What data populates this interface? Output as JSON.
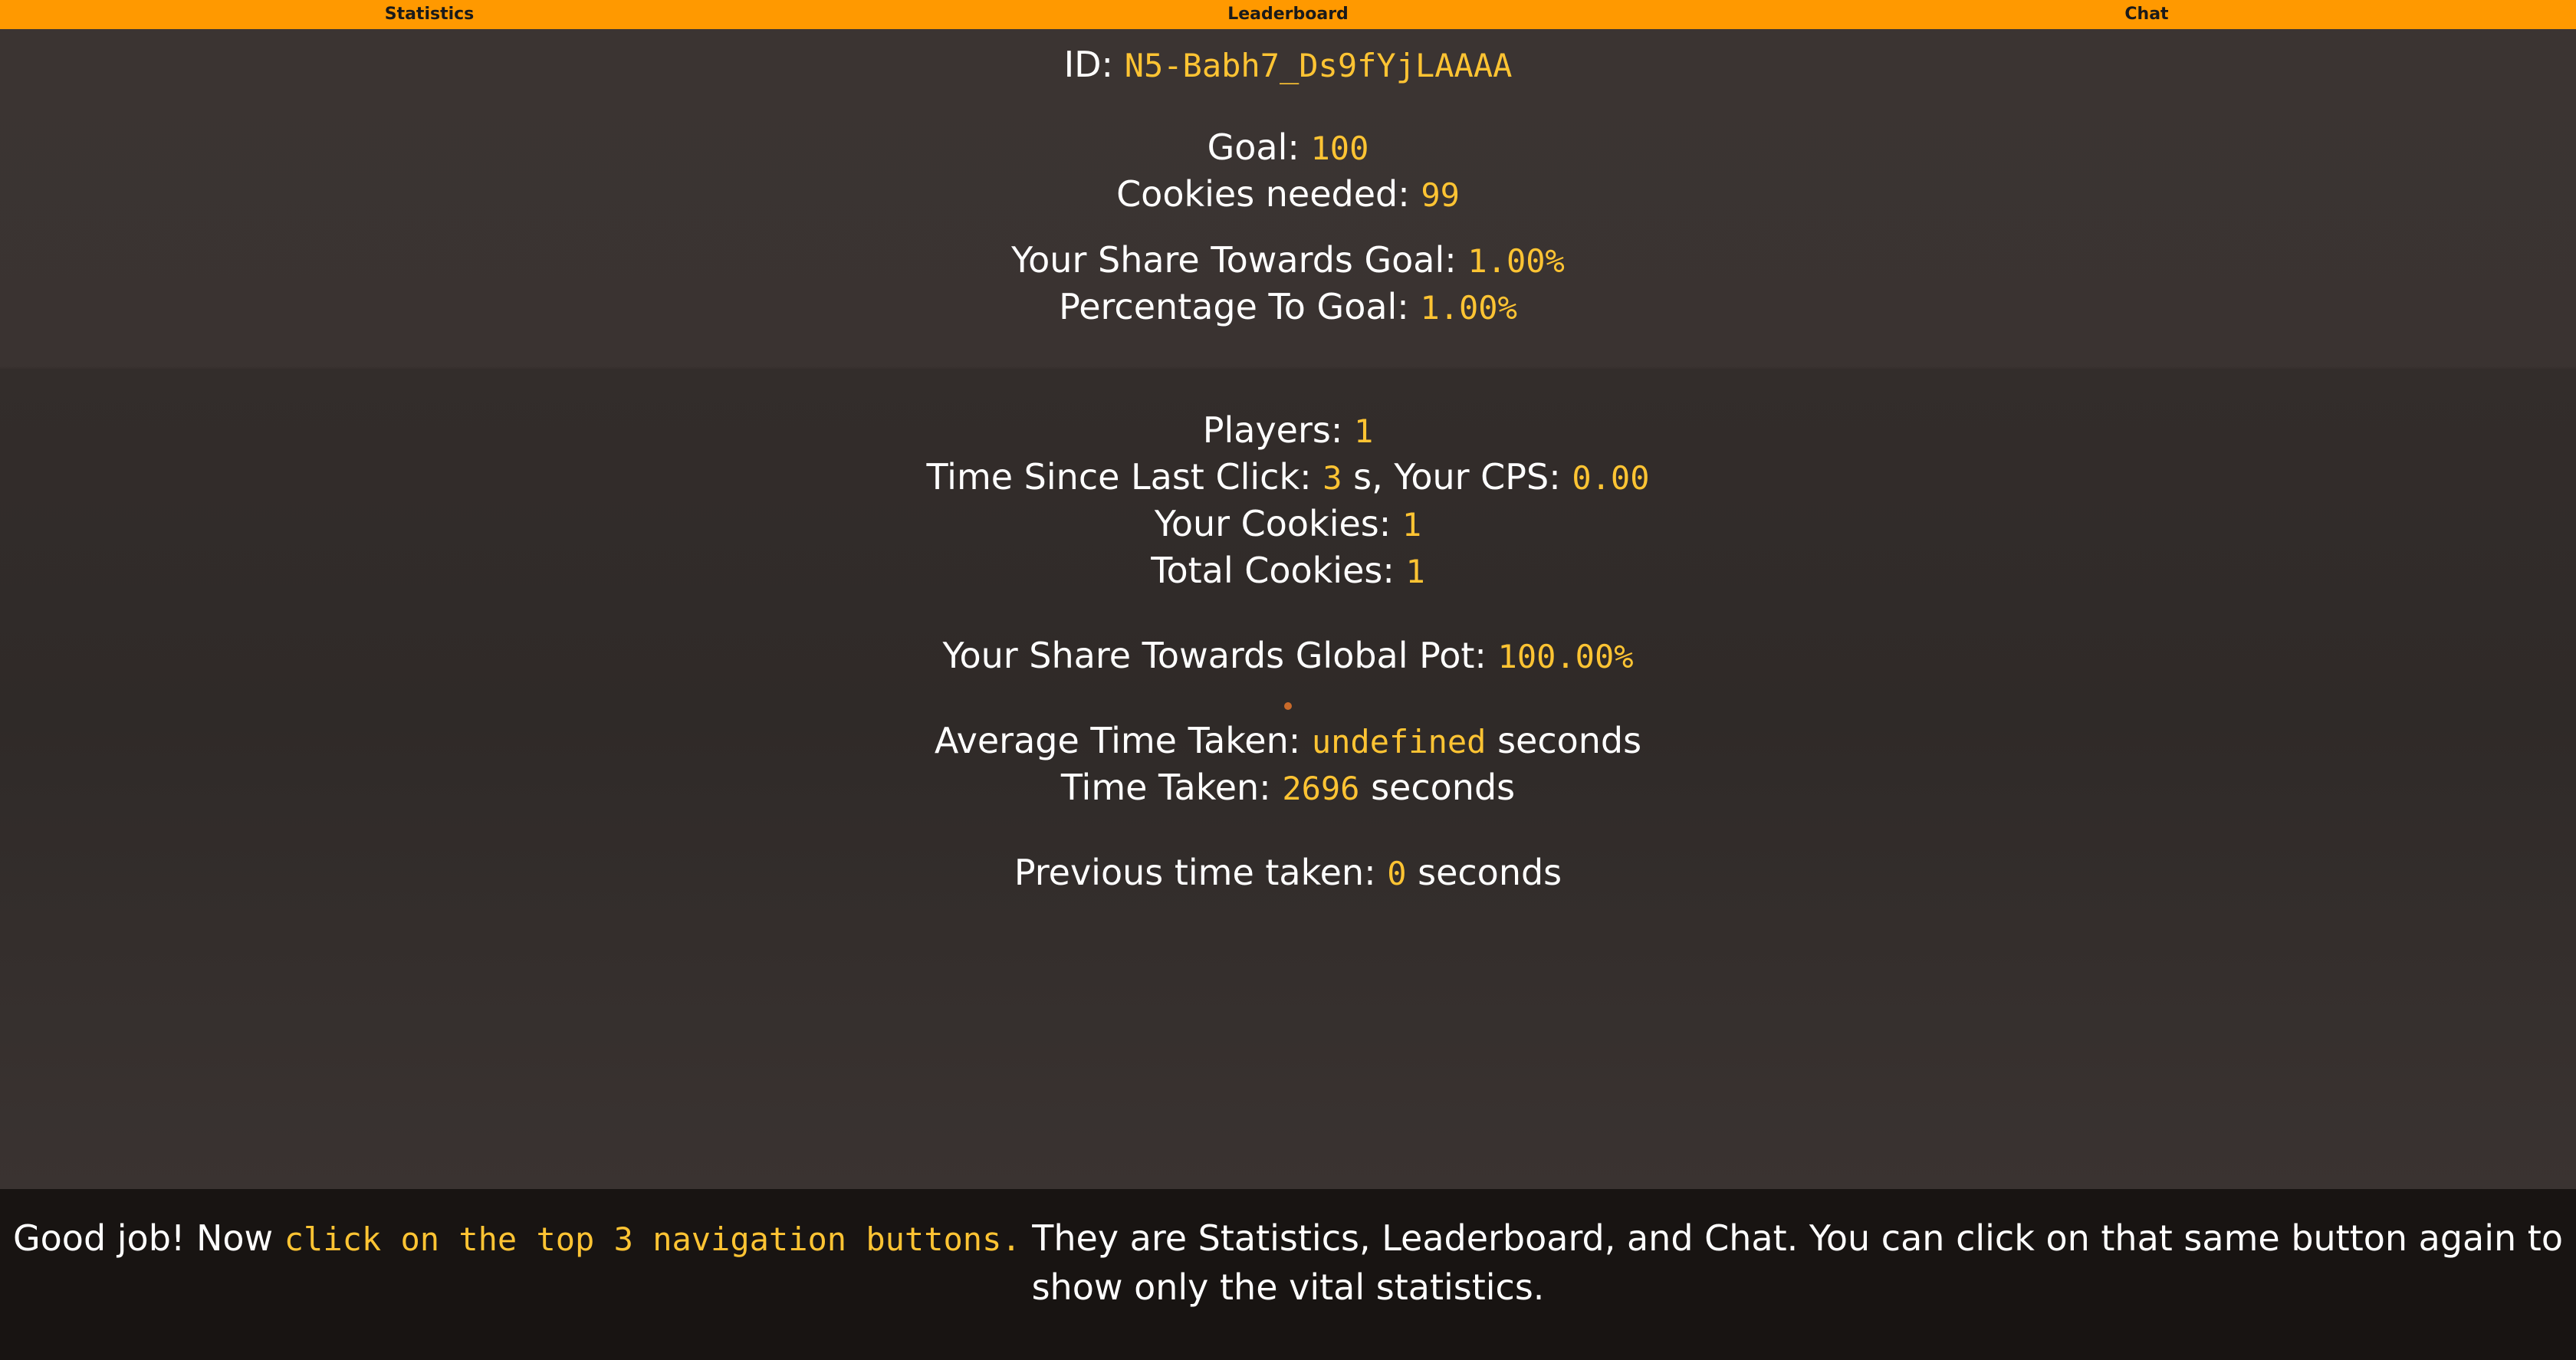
{
  "nav": {
    "statistics": "Statistics",
    "leaderboard": "Leaderboard",
    "chat": "Chat"
  },
  "stats": {
    "id_label": "ID:",
    "id_value": "N5-Babh7_Ds9fYjLAAAA",
    "goal_label": "Goal:",
    "goal_value": "100",
    "cookies_needed_label": "Cookies needed:",
    "cookies_needed_value": "99",
    "share_goal_label": "Your Share Towards Goal:",
    "share_goal_value": "1.00%",
    "pct_goal_label": "Percentage To Goal:",
    "pct_goal_value": "1.00%",
    "players_label": "Players:",
    "players_value": "1",
    "since_click_label": "Time Since Last Click:",
    "since_click_value": "3",
    "cps_label": "s, Your CPS:",
    "cps_value": "0.00",
    "your_cookies_label": "Your Cookies:",
    "your_cookies_value": "1",
    "total_cookies_label": "Total Cookies:",
    "total_cookies_value": "1",
    "share_pot_label": "Your Share Towards Global Pot:",
    "share_pot_value": "100.00%",
    "avg_time_label": "Average Time Taken:",
    "avg_time_value": "undefined",
    "avg_time_unit": "seconds",
    "time_taken_label": "Time Taken:",
    "time_taken_value": "2696",
    "time_taken_unit": "seconds",
    "prev_time_label": "Previous time taken:",
    "prev_time_value": "0",
    "prev_time_unit": "seconds"
  },
  "footer": {
    "prefix": "Good job! Now ",
    "highlight": "click on the top 3 navigation buttons.",
    "suffix": " They are Statistics, Leaderboard, and Chat. You can click on that same button again to show only the vital statistics."
  },
  "colors": {
    "accent": "#ff9900",
    "value": "#ffc433",
    "background": "#3a3331",
    "footer_bg": "#181412"
  }
}
